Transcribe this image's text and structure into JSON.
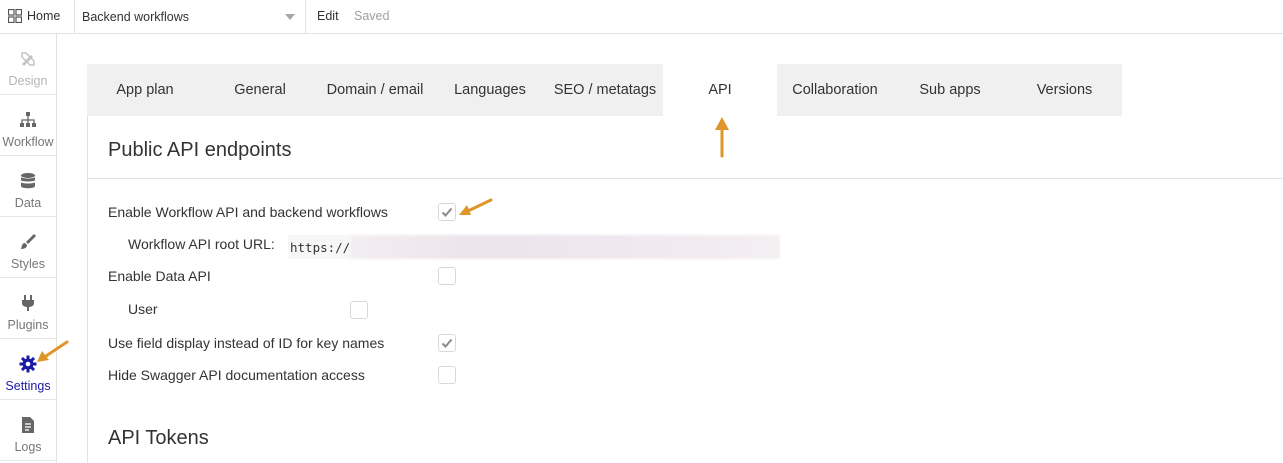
{
  "topbar": {
    "home_label": "Home",
    "page_select_value": "Backend workflows",
    "edit_label": "Edit",
    "saved_label": "Saved"
  },
  "sidebar": {
    "items": [
      {
        "label": "Design",
        "icon": "design-icon"
      },
      {
        "label": "Workflow",
        "icon": "workflow-icon"
      },
      {
        "label": "Data",
        "icon": "database-icon"
      },
      {
        "label": "Styles",
        "icon": "brush-icon"
      },
      {
        "label": "Plugins",
        "icon": "plug-icon"
      },
      {
        "label": "Settings",
        "icon": "gear-icon"
      },
      {
        "label": "Logs",
        "icon": "document-icon"
      }
    ],
    "active": "Settings"
  },
  "tabs": [
    {
      "label": "App plan"
    },
    {
      "label": "General"
    },
    {
      "label": "Domain / email"
    },
    {
      "label": "Languages"
    },
    {
      "label": "SEO / metatags"
    },
    {
      "label": "API"
    },
    {
      "label": "Collaboration"
    },
    {
      "label": "Sub apps"
    },
    {
      "label": "Versions"
    }
  ],
  "active_tab": "API",
  "api": {
    "public_title": "Public API endpoints",
    "enable_workflow_label": "Enable Workflow API and backend workflows",
    "enable_workflow_checked": true,
    "root_url_label": "Workflow API root URL:",
    "root_url_prefix": "https://",
    "enable_data_label": "Enable Data API",
    "enable_data_checked": false,
    "user_label": "User",
    "user_checked": false,
    "field_display_label": "Use field display instead of ID for key names",
    "field_display_checked": true,
    "hide_swagger_label": "Hide Swagger API documentation access",
    "hide_swagger_checked": false,
    "tokens_title": "API Tokens"
  },
  "colors": {
    "accent_blue": "#1b1ba8",
    "annotation_arrow": "#e0952a",
    "tab_bg": "#f0f0f0"
  }
}
